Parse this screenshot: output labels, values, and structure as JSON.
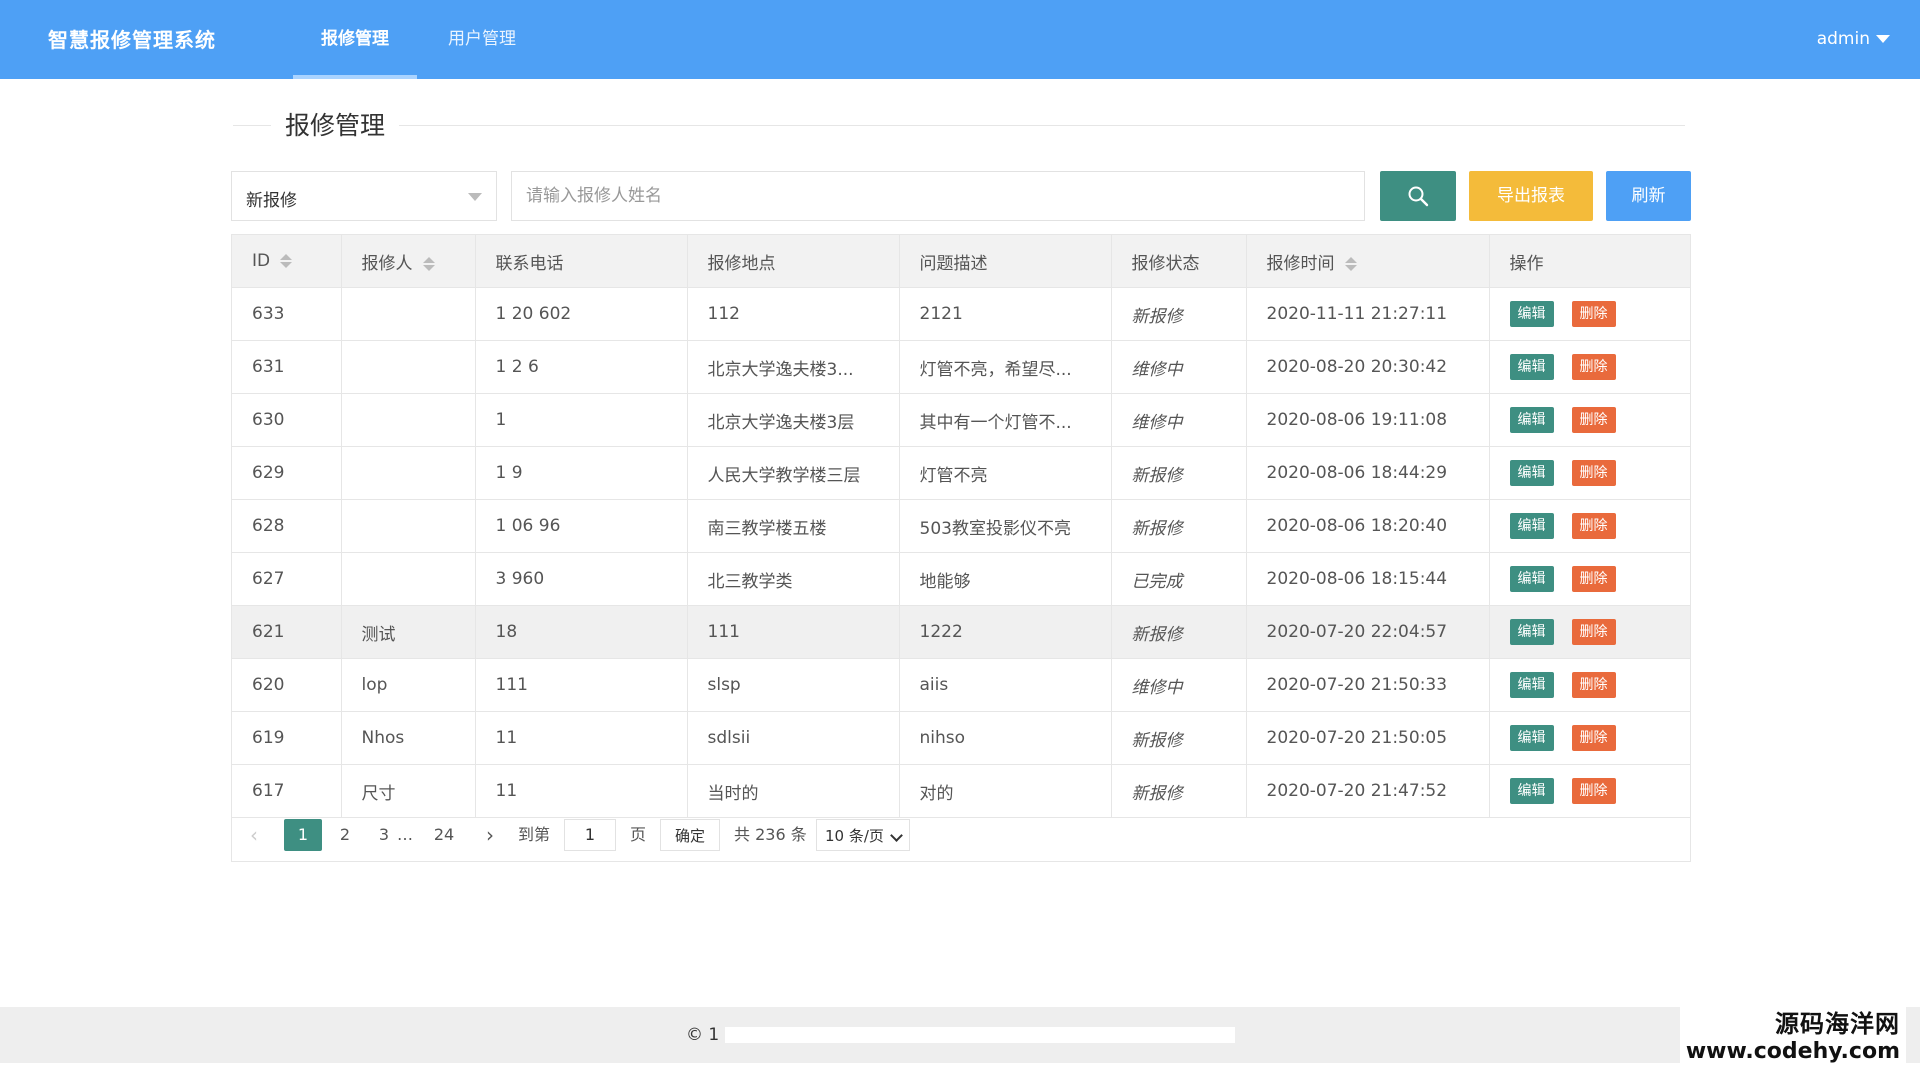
{
  "app": {
    "title": "智慧报修管理系统"
  },
  "nav": {
    "items": [
      {
        "label": "报修管理",
        "active": true
      },
      {
        "label": "用户管理",
        "active": false
      }
    ]
  },
  "user": {
    "name": "admin"
  },
  "page": {
    "title": "报修管理"
  },
  "filter": {
    "selected": "新报修"
  },
  "search": {
    "placeholder": "请输入报修人姓名",
    "value": ""
  },
  "buttons": {
    "search_icon": "search-icon",
    "export": "导出报表",
    "refresh": "刷新"
  },
  "table": {
    "headers": [
      "ID",
      "报修人",
      "联系电话",
      "报修地点",
      "问题描述",
      "报修状态",
      "报修时间",
      "操作"
    ],
    "rows": [
      {
        "id": "633",
        "reporter": "",
        "phone": "1 20 602",
        "location": "112",
        "desc": "2121",
        "status": "新报修",
        "time": "2020-11-11 21:27:11"
      },
      {
        "id": "631",
        "reporter": "",
        "phone": "1 2 6",
        "location": "北京大学逸夫楼3...",
        "desc": "灯管不亮，希望尽...",
        "status": "维修中",
        "time": "2020-08-20 20:30:42"
      },
      {
        "id": "630",
        "reporter": "",
        "phone": "1",
        "location": "北京大学逸夫楼3层",
        "desc": "其中有一个灯管不...",
        "status": "维修中",
        "time": "2020-08-06 19:11:08"
      },
      {
        "id": "629",
        "reporter": "",
        "phone": "1 9",
        "location": "人民大学教学楼三层",
        "desc": "灯管不亮",
        "status": "新报修",
        "time": "2020-08-06 18:44:29"
      },
      {
        "id": "628",
        "reporter": "",
        "phone": "1 06 96",
        "location": "南三教学楼五楼",
        "desc": "503教室投影仪不亮",
        "status": "新报修",
        "time": "2020-08-06 18:20:40"
      },
      {
        "id": "627",
        "reporter": "",
        "phone": "3 960",
        "location": "北三教学类",
        "desc": "地能够",
        "status": "已完成",
        "time": "2020-08-06 18:15:44"
      },
      {
        "id": "621",
        "reporter": "测试",
        "phone": "18",
        "location": "111",
        "desc": "1222",
        "status": "新报修",
        "time": "2020-07-20 22:04:57"
      },
      {
        "id": "620",
        "reporter": "lop",
        "phone": "111",
        "location": "slsp",
        "desc": "aiis",
        "status": "维修中",
        "time": "2020-07-20 21:50:33"
      },
      {
        "id": "619",
        "reporter": "Nhos",
        "phone": "11",
        "location": "sdlsii",
        "desc": "nihso",
        "status": "新报修",
        "time": "2020-07-20 21:50:05"
      },
      {
        "id": "617",
        "reporter": "尺寸",
        "phone": "11",
        "location": "当时的",
        "desc": "对的",
        "status": "新报修",
        "time": "2020-07-20 21:47:52"
      }
    ],
    "highlight_row": 6,
    "action_labels": {
      "edit": "编辑",
      "delete": "删除"
    }
  },
  "pager": {
    "pages": [
      "1",
      "2",
      "3",
      "…",
      "24"
    ],
    "current": "1",
    "goto_label": "到第",
    "goto_value": "1",
    "page_unit": "页",
    "confirm": "确定",
    "total": "共 236 条",
    "page_size": "10 条/页"
  },
  "footer": {
    "text": "© 1"
  },
  "watermark": {
    "line1": "源码海洋网",
    "line2": "www.codehy.com"
  },
  "colors": {
    "header": "#4ea0f5",
    "primary": "#3e8f82",
    "warning": "#f4bb3a",
    "danger": "#e96a3c"
  }
}
